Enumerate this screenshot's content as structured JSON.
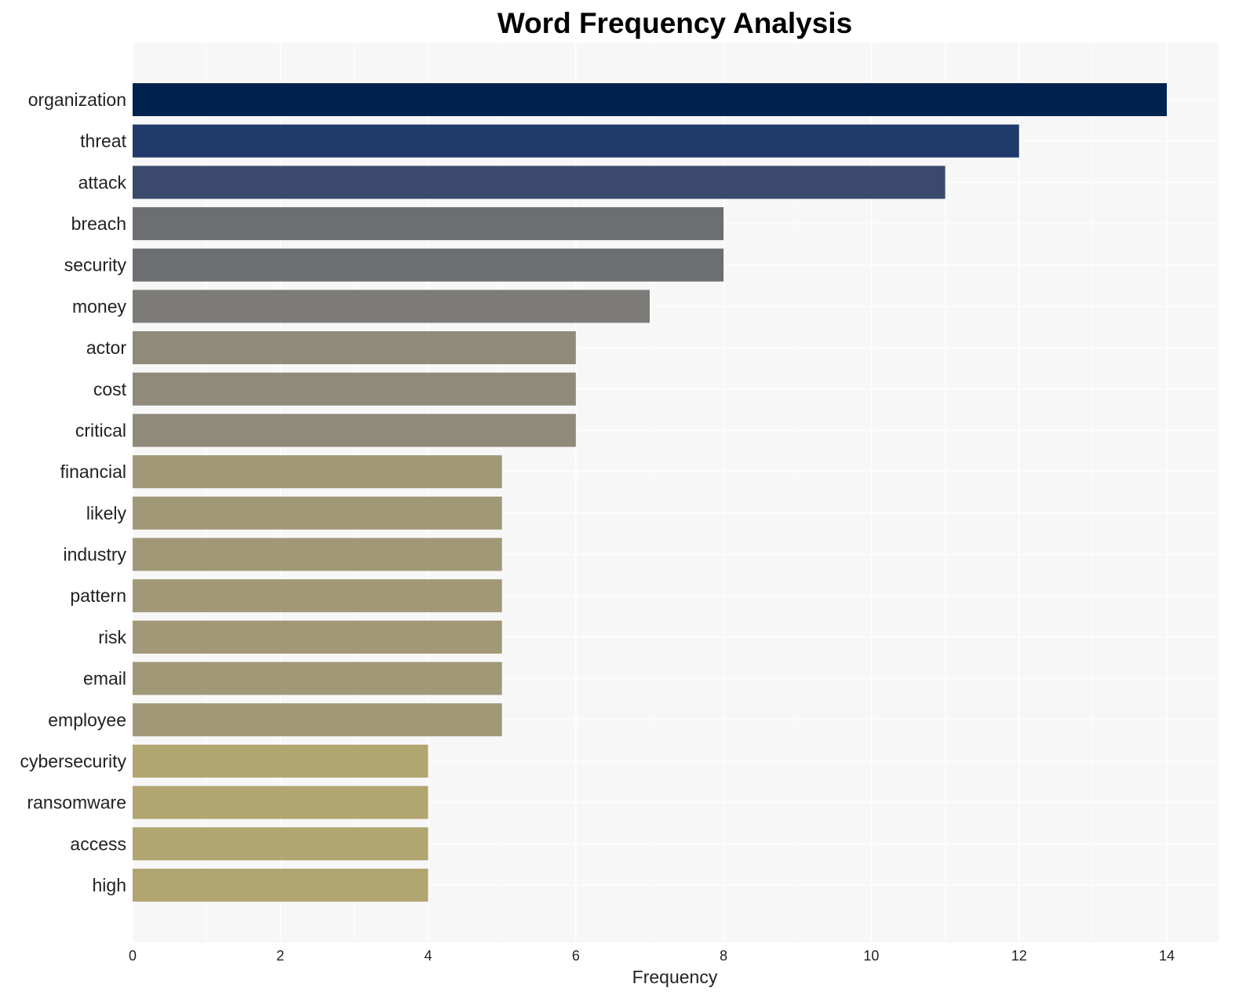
{
  "chart_data": {
    "type": "bar",
    "orientation": "horizontal",
    "title": "Word Frequency Analysis",
    "xlabel": "Frequency",
    "ylabel": "",
    "xlim": [
      0,
      14.7
    ],
    "xticks": [
      0,
      2,
      4,
      6,
      8,
      10,
      12,
      14
    ],
    "grid": true,
    "legend": "none",
    "categories": [
      "organization",
      "threat",
      "attack",
      "breach",
      "security",
      "money",
      "actor",
      "cost",
      "critical",
      "financial",
      "likely",
      "industry",
      "pattern",
      "risk",
      "email",
      "employee",
      "cybersecurity",
      "ransomware",
      "access",
      "high"
    ],
    "values": [
      14,
      12,
      11,
      8,
      8,
      7,
      6,
      6,
      6,
      5,
      5,
      5,
      5,
      5,
      5,
      5,
      4,
      4,
      4,
      4
    ],
    "colors": [
      "#00224e",
      "#213a6c",
      "#3b496c",
      "#6c6e72",
      "#6c6e72",
      "#7c7b78",
      "#8f8a79",
      "#8f8a79",
      "#8f8a79",
      "#a09877",
      "#a09877",
      "#a09877",
      "#a09877",
      "#a09877",
      "#a09877",
      "#a09877",
      "#b1a570",
      "#b1a570",
      "#b1a570",
      "#b1a570"
    ],
    "background": "#f7f7f7"
  }
}
